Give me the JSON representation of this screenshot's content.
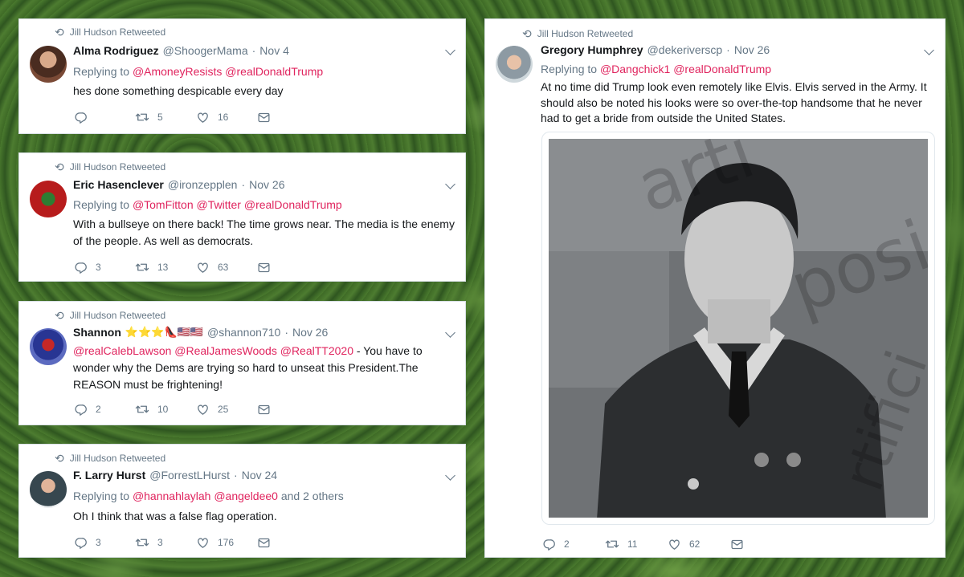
{
  "tweets": [
    {
      "retweeted_by": "Jill Hudson Retweeted",
      "name": "Alma Rodriguez",
      "handle": "@ShoogerMama",
      "date": "Nov 4",
      "replying_label": "Replying to",
      "mentions": [
        "@AmoneyResists",
        "@realDonaldTrump"
      ],
      "text": "hes done something despicable every day",
      "replies": "",
      "retweets": "5",
      "likes": "16"
    },
    {
      "retweeted_by": "Jill Hudson Retweeted",
      "name": "Eric Hasenclever",
      "handle": "@ironzepplen",
      "date": "Nov 26",
      "replying_label": "Replying to",
      "mentions": [
        "@TomFitton",
        "@Twitter",
        "@realDonaldTrump"
      ],
      "text": "With a bullseye on there back! The time grows near. The media is the enemy of the people. As well as democrats.",
      "replies": "3",
      "retweets": "13",
      "likes": "63"
    },
    {
      "retweeted_by": "Jill Hudson Retweeted",
      "name": "Shannon",
      "name_emoji": "⭐⭐⭐👠🇺🇸🇺🇸",
      "handle": "@shannon710",
      "date": "Nov 26",
      "mentions": [
        "@realCalebLawson",
        "@RealJamesWoods",
        "@RealTT2020"
      ],
      "text": " - You have to wonder why the Dems are trying so hard to unseat this President.The REASON must be frightening!",
      "replies": "2",
      "retweets": "10",
      "likes": "25"
    },
    {
      "retweeted_by": "Jill Hudson Retweeted",
      "name": "F. Larry Hurst",
      "handle": "@ForrestLHurst",
      "date": "Nov 24",
      "replying_label": "Replying to",
      "mentions": [
        "@hannahlaylah",
        "@angeldee0"
      ],
      "others": "and 2 others",
      "text": "Oh I think that was a false flag operation.",
      "replies": "3",
      "retweets": "3",
      "likes": "176"
    },
    {
      "retweeted_by": "Jill Hudson Retweeted",
      "name": "Gregory Humphrey",
      "handle": "@dekeriverscp",
      "date": "Nov 26",
      "replying_label": "Replying to",
      "mentions": [
        "@Dangchick1",
        "@realDonaldTrump"
      ],
      "text": "At no time did Trump look even remotely like Elvis.  Elvis served in the Army.  It should also be noted his looks were so over-the-top handsome that he never had to get a bride from outside the United States.",
      "replies": "2",
      "retweets": "11",
      "likes": "62",
      "watermark": [
        "arti",
        "posi",
        "rtifici"
      ]
    }
  ],
  "colors": {
    "mention": "#e0245e",
    "secondary_text": "#657786",
    "card_background": "#ffffff",
    "page_background": "#3f6b28"
  },
  "icons": [
    "retweet-icon",
    "reply-icon",
    "like-icon",
    "message-icon",
    "chevron-down-icon"
  ]
}
